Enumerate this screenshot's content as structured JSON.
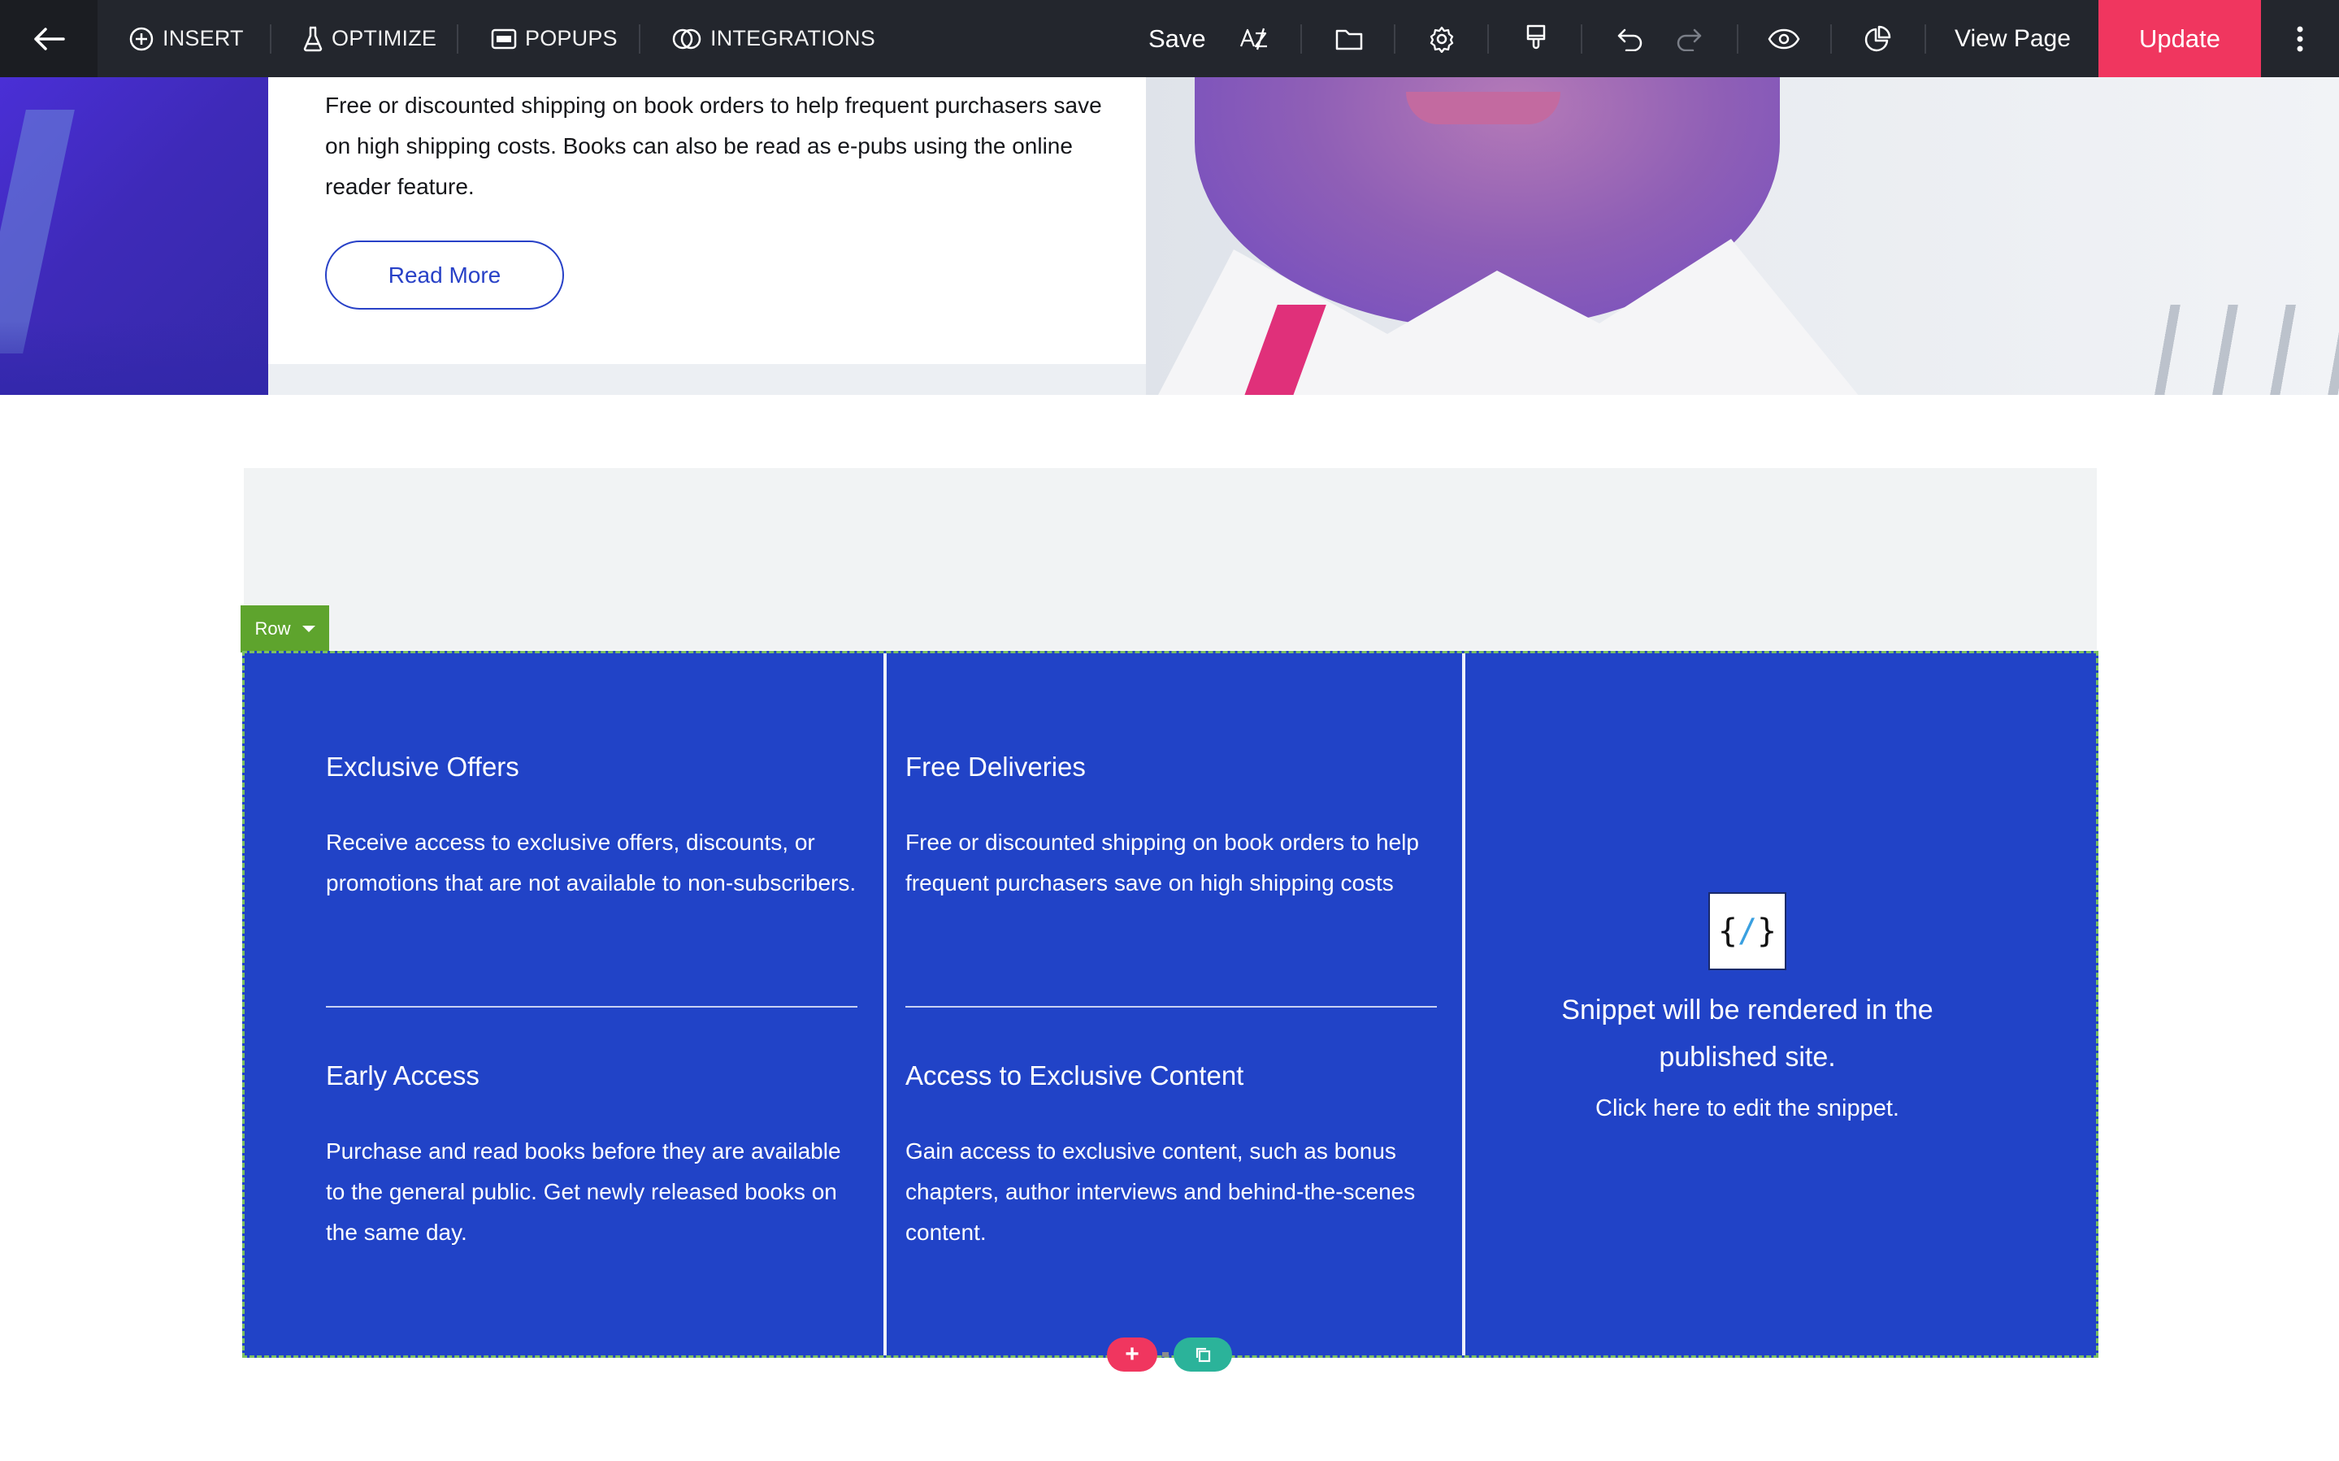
{
  "toolbar": {
    "insert_label": "INSERT",
    "optimize_label": "OPTIMIZE",
    "popups_label": "POPUPS",
    "integrations_label": "INTEGRATIONS",
    "save_label": "Save",
    "view_page_label": "View Page",
    "update_label": "Update",
    "icons": [
      "back-arrow-icon",
      "plus-circle-icon",
      "flask-icon",
      "popup-window-icon",
      "integrations-rings-icon",
      "spellcheck-icon",
      "folder-icon",
      "settings-gear-icon",
      "paint-brush-icon",
      "undo-icon",
      "redo-icon",
      "eye-preview-icon",
      "analytics-pie-icon",
      "more-vertical-icon"
    ],
    "update_color": "#f0365f"
  },
  "hero": {
    "body_text": "Free or discounted shipping on book orders to help frequent purchasers save on high shipping costs. Books can also be read as e-pubs using the online reader feature.",
    "read_more_label": "Read More"
  },
  "row_tag": {
    "label": "Row",
    "color": "#5ea42d"
  },
  "features": {
    "col1": [
      {
        "title": "Exclusive Offers",
        "body": "Receive access to exclusive offers, discounts, or promotions that are not available to non-subscribers."
      },
      {
        "title": "Early Access",
        "body": "Purchase and read books before they are available to the general public. Get newly released books on the same day."
      }
    ],
    "col2": [
      {
        "title": "Free Deliveries",
        "body": "Free or discounted shipping on book orders to help frequent purchasers save on high shipping costs"
      },
      {
        "title": "Access to Exclusive Content",
        "body": "Gain access to exclusive content, such as bonus chapters, author interviews and behind-the-scenes content."
      }
    ]
  },
  "snippet": {
    "icon_text": "{/}",
    "line1": "Snippet will be rendered in the published site.",
    "line2": "Click here to edit the snippet."
  },
  "row_controls": {
    "add_label": "+"
  },
  "colors": {
    "section_blue": "#2143c7",
    "accent_blue": "#2841c7",
    "toolbar_bg": "#23262d"
  }
}
